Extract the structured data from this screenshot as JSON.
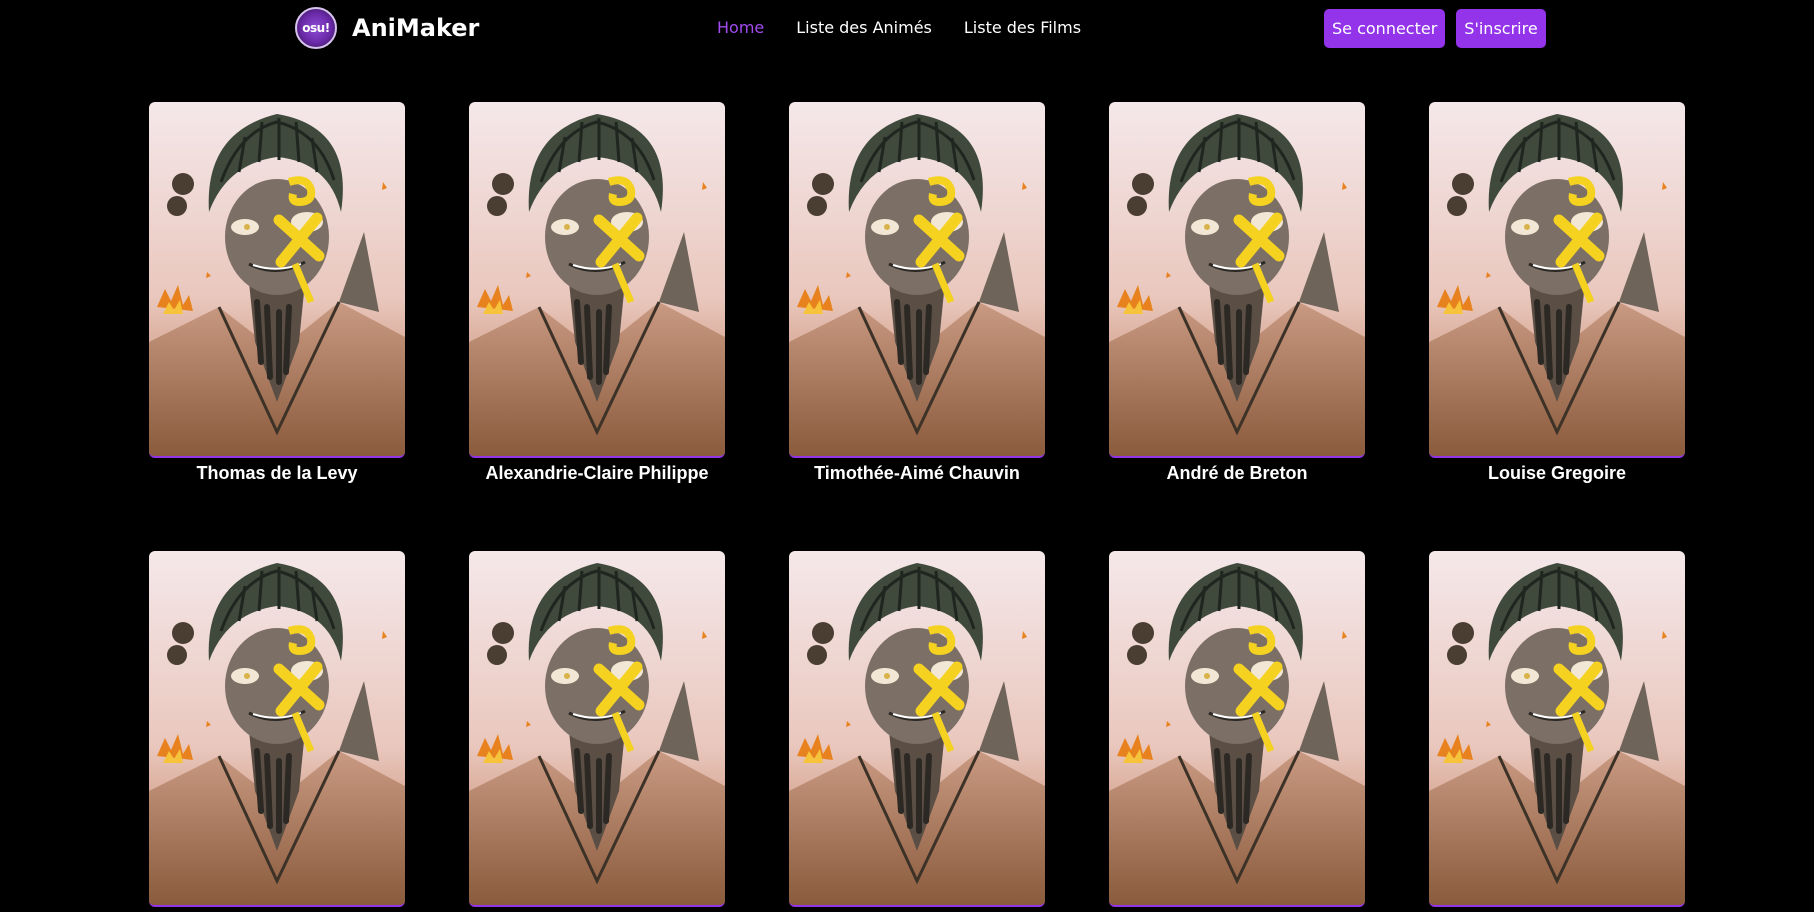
{
  "navbar": {
    "logo_text": "osu!",
    "brand": "AniMaker",
    "links": [
      {
        "label": "Home",
        "active": true
      },
      {
        "label": "Liste des Animés",
        "active": false
      },
      {
        "label": "Liste des Films",
        "active": false
      }
    ],
    "login_label": "Se connecter",
    "signup_label": "S'inscrire"
  },
  "accent_color": "#9333ea",
  "characters": [
    {
      "name": "Thomas de la Levy"
    },
    {
      "name": "Alexandrie-Claire Philippe"
    },
    {
      "name": "Timothée-Aimé Chauvin"
    },
    {
      "name": "André de Breton"
    },
    {
      "name": "Louise Gregoire"
    },
    {
      "name": ""
    },
    {
      "name": ""
    },
    {
      "name": ""
    },
    {
      "name": ""
    },
    {
      "name": ""
    }
  ]
}
